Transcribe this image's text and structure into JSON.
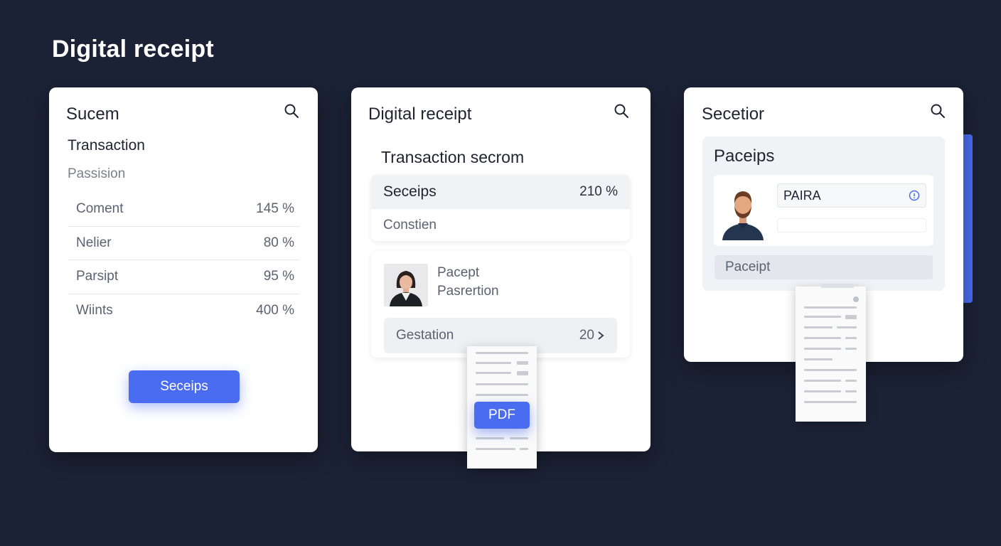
{
  "page_title": "Digital receipt",
  "card1": {
    "title": "Sucem",
    "subtitle": "Transaction",
    "label": "Passision",
    "rows": [
      {
        "label": "Coment",
        "value": "145 %"
      },
      {
        "label": "Nelier",
        "value": "80 %"
      },
      {
        "label": "Parsipt",
        "value": "95 %"
      },
      {
        "label": "Wiints",
        "value": "400 %"
      }
    ],
    "button_label": "Seceips"
  },
  "card2": {
    "title": "Digital receipt",
    "section_title": "Transaction secrom",
    "panel_title": "Seceips",
    "panel_value": "210 %",
    "panel_row": "Constien",
    "profile_line1": "Pacept",
    "profile_line2": "Pasrertion",
    "gestation_label": "Gestation",
    "gestation_value": "20"
  },
  "pdf_label": "PDF",
  "card3": {
    "title": "Secetior",
    "inner_title": "Paceips",
    "field_value": "PAIRA",
    "bar_label": "Paceipt"
  },
  "icons": {
    "search": "search-icon",
    "chevron": "chevron-right-icon",
    "info": "info-icon"
  },
  "colors": {
    "background": "#1b2235",
    "accent": "#4a6cf0",
    "card": "#ffffff"
  }
}
